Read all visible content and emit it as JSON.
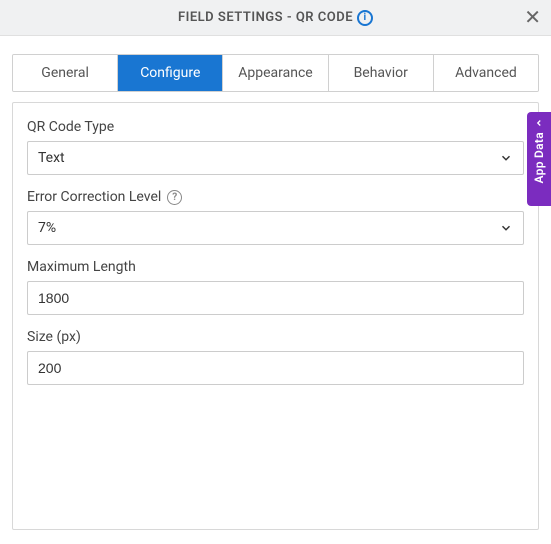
{
  "header": {
    "title": "FIELD SETTINGS - QR CODE"
  },
  "tabs": {
    "items": [
      {
        "label": "General"
      },
      {
        "label": "Configure"
      },
      {
        "label": "Appearance"
      },
      {
        "label": "Behavior"
      },
      {
        "label": "Advanced"
      }
    ],
    "activeIndex": 1
  },
  "form": {
    "qrCodeType": {
      "label": "QR Code Type",
      "value": "Text"
    },
    "errorCorrection": {
      "label": "Error Correction Level",
      "value": "7%"
    },
    "maxLength": {
      "label": "Maximum Length",
      "value": "1800"
    },
    "size": {
      "label": "Size (px)",
      "value": "200"
    }
  },
  "sideTab": {
    "label": "App Data"
  }
}
